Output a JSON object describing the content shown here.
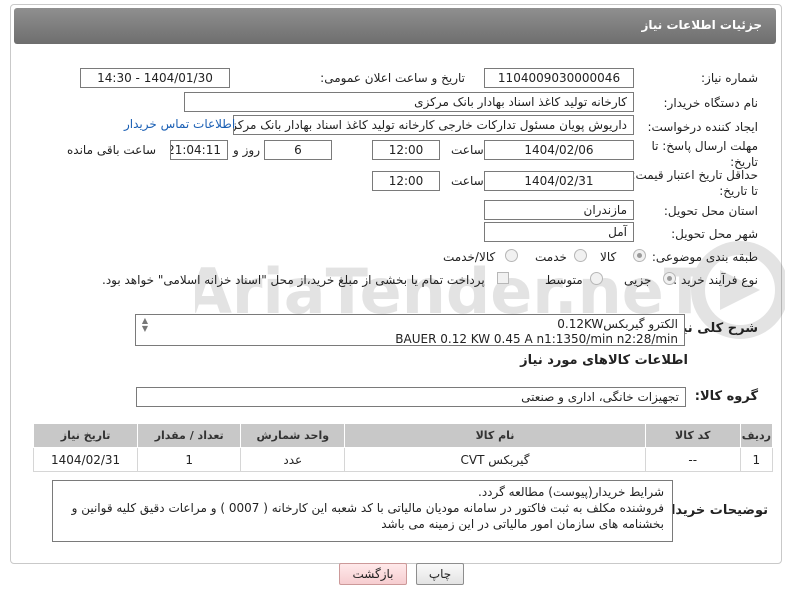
{
  "header": {
    "title": "جزئیات اطلاعات نیاز"
  },
  "form": {
    "need_number_label": "شماره نیاز:",
    "need_number": "1104009030000046",
    "announce_label": "تاریخ و ساعت اعلان عمومی:",
    "announce_value": "1404/01/30 - 14:30",
    "buyer_org_label": "نام دستگاه خریدار:",
    "buyer_org": "کارخانه تولید کاغذ اسناد بهادار بانک مرکزی",
    "creator_label": "ایجاد کننده درخواست:",
    "creator": "داریوش  پویان مسئول تدارکات خارجی کارخانه تولید کاغذ اسناد بهادار بانک مرکزی",
    "contact_link": "اطلاعات تماس خریدار",
    "reply_deadline_label": "مهلت ارسال پاسخ: تا تاریخ:",
    "reply_date": "1404/02/06",
    "time_label": "ساعت",
    "reply_time": "12:00",
    "days_value": "6",
    "days_label": "روز و",
    "remaining_time": "21:04:11",
    "remaining_label": "ساعت باقی مانده",
    "price_deadline_label": "حداقل تاریخ اعتبار قیمت: تا تاریخ:",
    "price_date": "1404/02/31",
    "price_time": "12:00",
    "province_label": "استان محل تحویل:",
    "province": "مازندران",
    "city_label": "شهر محل تحویل:",
    "city": "آمل",
    "category_label": "طبقه بندی موضوعی:",
    "category_options": [
      "کالا",
      "خدمت",
      "کالا/خدمت"
    ],
    "process_label": "نوع فرآیند خرید :",
    "process_options": [
      "جزیی",
      "متوسط"
    ],
    "payment_note": "پرداخت تمام یا بخشی از مبلغ خرید،از محل \"اسناد خزانه اسلامی\" خواهد بود.",
    "summary_label": "شرح کلی نیاز:",
    "summary_line1": "الکترو گیربکس0.12KW",
    "summary_line2": "BAUER  0.12 KW  0.45 A  n1:1350/min     n2:28/min",
    "goods_info_title": "اطلاعات کالاهای مورد نیاز",
    "goods_group_label": "گروه کالا:",
    "goods_group": "تجهیزات خانگی، اداری و صنعتی"
  },
  "table": {
    "headers": [
      "ردیف",
      "کد کالا",
      "نام کالا",
      "واحد شمارش",
      "تعداد / مقدار",
      "تاریخ نیاز"
    ],
    "rows": [
      [
        "1",
        "--",
        "گیربکس CVT",
        "عدد",
        "1",
        "1404/02/31"
      ]
    ]
  },
  "buyer_notes": {
    "label": "توضیحات خریدار:",
    "line1": "شرایط  خریدار(پیوست) مطالعه گردد.",
    "line2": "فروشنده مکلف به ثبت فاکتور در سامانه مودیان مالیاتی با کد شعبه این کارخانه ( 0007 ) و مراعات دقیق کلیه قوانین و",
    "line3": "بخشنامه های سازمان امور مالیاتی در این زمینه می باشد"
  },
  "buttons": {
    "print": "چاپ",
    "back": "بازگشت"
  },
  "watermark": {
    "text": "AriaTender.neT"
  }
}
